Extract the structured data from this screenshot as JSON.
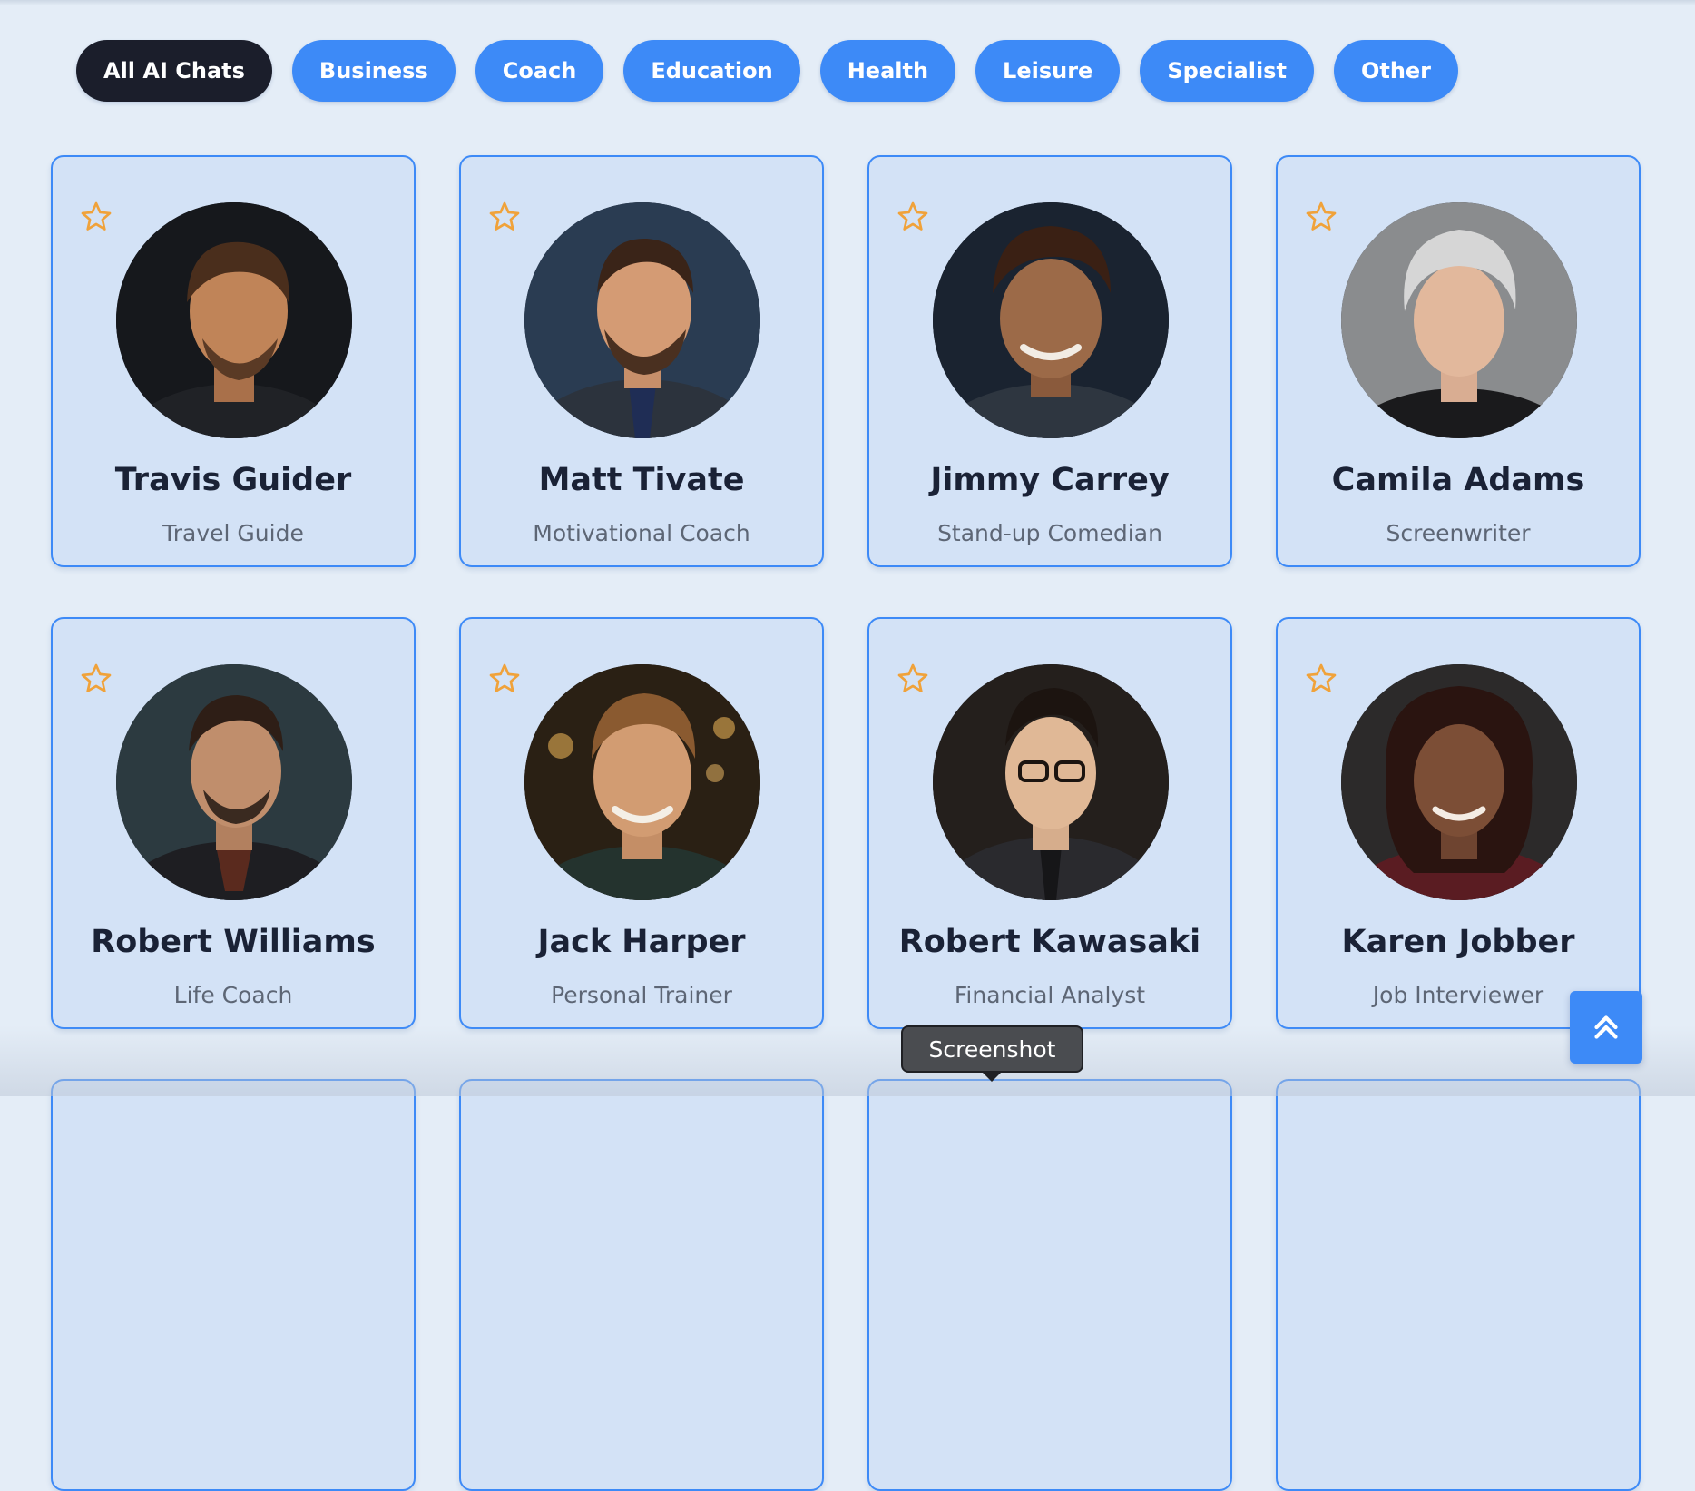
{
  "filters": [
    {
      "label": "All AI Chats",
      "active": true
    },
    {
      "label": "Business",
      "active": false
    },
    {
      "label": "Coach",
      "active": false
    },
    {
      "label": "Education",
      "active": false
    },
    {
      "label": "Health",
      "active": false
    },
    {
      "label": "Leisure",
      "active": false
    },
    {
      "label": "Specialist",
      "active": false
    },
    {
      "label": "Other",
      "active": false
    }
  ],
  "cards": [
    {
      "name": "Travis Guider",
      "role": "Travel Guide"
    },
    {
      "name": "Matt Tivate",
      "role": "Motivational Coach"
    },
    {
      "name": "Jimmy Carrey",
      "role": "Stand-up Comedian"
    },
    {
      "name": "Camila Adams",
      "role": "Screenwriter"
    },
    {
      "name": "Robert Williams",
      "role": "Life Coach"
    },
    {
      "name": "Jack Harper",
      "role": "Personal Trainer"
    },
    {
      "name": "Robert Kawasaki",
      "role": "Financial Analyst"
    },
    {
      "name": "Karen Jobber",
      "role": "Job Interviewer"
    }
  ],
  "tooltip": {
    "text": "Screenshot"
  },
  "icons": {
    "favorite": "star-outline-icon",
    "scroll_top": "double-chevron-up-icon"
  },
  "colors": {
    "accent": "#3d8af7",
    "active_pill": "#1b1e2b",
    "card_bg": "#d3e2f6",
    "page_bg": "#e4edf7",
    "star": "#f0a23a"
  }
}
